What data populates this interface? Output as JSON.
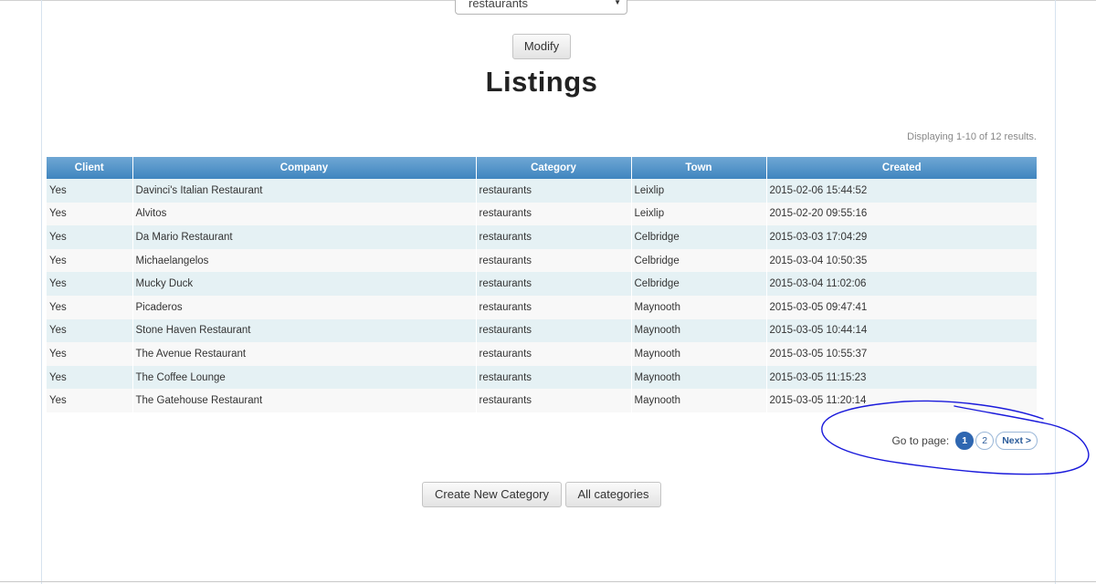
{
  "filter": {
    "selected_value": "restaurants"
  },
  "toolbar": {
    "modify_label": "Modify"
  },
  "page_title": "Listings",
  "summary": "Displaying 1-10 of 12 results.",
  "table": {
    "columns": [
      "Client",
      "Company",
      "Category",
      "Town",
      "Created"
    ],
    "rows": [
      [
        "Yes",
        "Davinci's Italian Restaurant",
        "restaurants",
        "Leixlip",
        "2015-02-06 15:44:52"
      ],
      [
        "Yes",
        "Alvitos",
        "restaurants",
        "Leixlip",
        "2015-02-20 09:55:16"
      ],
      [
        "Yes",
        "Da Mario Restaurant",
        "restaurants",
        "Celbridge",
        "2015-03-03 17:04:29"
      ],
      [
        "Yes",
        "Michaelangelos",
        "restaurants",
        "Celbridge",
        "2015-03-04 10:50:35"
      ],
      [
        "Yes",
        "Mucky Duck",
        "restaurants",
        "Celbridge",
        "2015-03-04 11:02:06"
      ],
      [
        "Yes",
        "Picaderos",
        "restaurants",
        "Maynooth",
        "2015-03-05 09:47:41"
      ],
      [
        "Yes",
        "Stone Haven Restaurant",
        "restaurants",
        "Maynooth",
        "2015-03-05 10:44:14"
      ],
      [
        "Yes",
        "The Avenue Restaurant",
        "restaurants",
        "Maynooth",
        "2015-03-05 10:55:37"
      ],
      [
        "Yes",
        "The Coffee Lounge",
        "restaurants",
        "Maynooth",
        "2015-03-05 11:15:23"
      ],
      [
        "Yes",
        "The Gatehouse Restaurant",
        "restaurants",
        "Maynooth",
        "2015-03-05 11:20:14"
      ]
    ]
  },
  "pager": {
    "label": "Go to page:",
    "pages": [
      "1",
      "2"
    ],
    "current": "1",
    "next_label": "Next >"
  },
  "actions": {
    "create_label": "Create New Category",
    "all_label": "All categories"
  },
  "colors": {
    "header_top": "#6fa7d4",
    "header_bottom": "#3f85bf",
    "row_odd": "#e5f1f4",
    "row_even": "#f8f8f8",
    "pager_current": "#2f67b1",
    "annotation": "#1a1adb"
  },
  "icons": {
    "select_caret": "chevron-down-icon"
  }
}
